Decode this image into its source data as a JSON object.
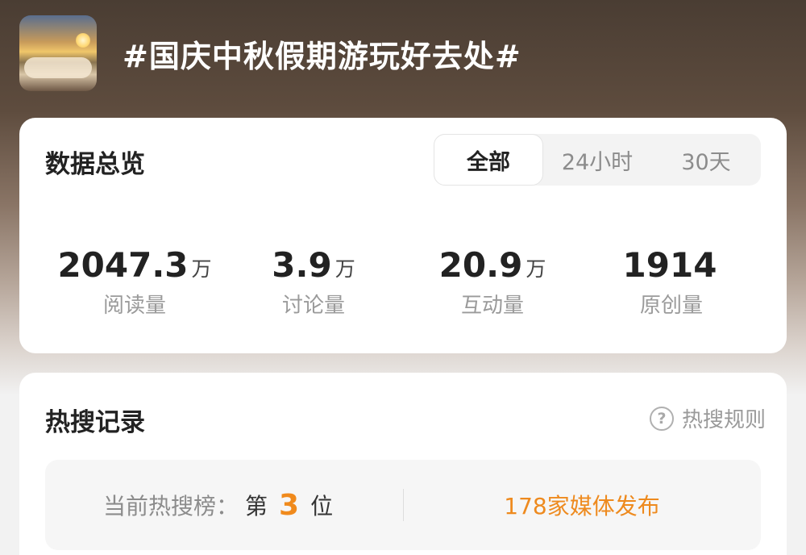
{
  "topic": {
    "title": "#国庆中秋假期游玩好去处#",
    "thumbnail": "sunrise-over-clouds-thumbnail"
  },
  "overview": {
    "title": "数据总览",
    "tabs": [
      {
        "label": "全部",
        "active": true
      },
      {
        "label": "24小时",
        "active": false
      },
      {
        "label": "30天",
        "active": false
      }
    ],
    "stats": [
      {
        "value": "2047.3",
        "unit": "万",
        "label": "阅读量"
      },
      {
        "value": "3.9",
        "unit": "万",
        "label": "讨论量"
      },
      {
        "value": "20.9",
        "unit": "万",
        "label": "互动量"
      },
      {
        "value": "1914",
        "unit": "",
        "label": "原创量"
      }
    ]
  },
  "hot_search": {
    "title": "热搜记录",
    "rules_label": "热搜规则",
    "rules_icon": "question-circle-icon",
    "rank_label": "当前热搜榜：",
    "rank_prefix": "第",
    "rank_value": "3",
    "rank_suffix": "位",
    "media_text": "178家媒体发布"
  },
  "colors": {
    "accent_orange": "#f08a1c",
    "card_bg": "#ffffff",
    "page_bg": "#f2f2f2",
    "header_bg": "#4a3d33"
  }
}
